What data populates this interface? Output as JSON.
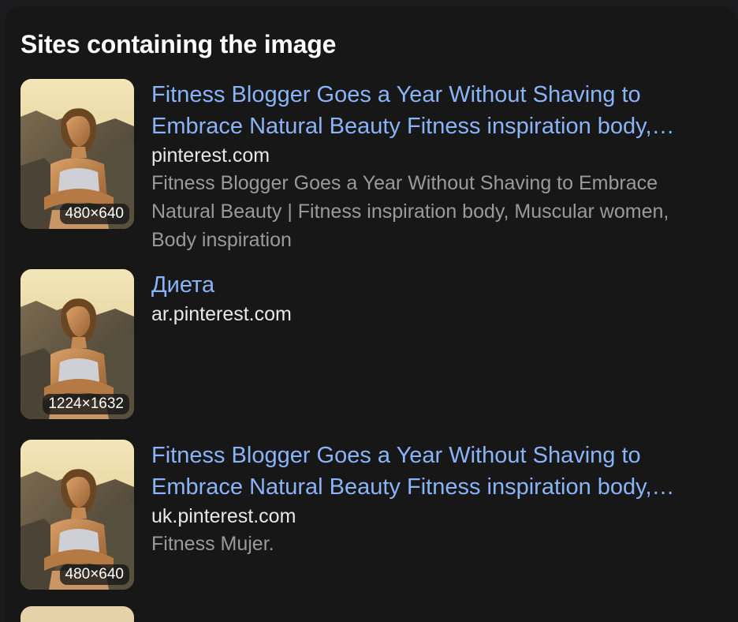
{
  "section": {
    "title": "Sites containing the image"
  },
  "results": [
    {
      "title": "Fitness Blogger Goes a Year Without Shaving to Embrace Natural Beauty Fitness inspiration body, Muscular women, Body inspiration",
      "site": "pinterest.com",
      "snippet": "Fitness Blogger Goes a Year Without Shaving to Embrace Natural Beauty | Fitness inspiration body, Muscular women, Body inspiration",
      "dimensions": "480×640"
    },
    {
      "title": "Диета",
      "site": "ar.pinterest.com",
      "snippet": "",
      "dimensions": "1224×1632"
    },
    {
      "title": "Fitness Blogger Goes a Year Without Shaving to Embrace Natural Beauty Fitness inspiration body, Muscular women, Body inspiration",
      "site": "uk.pinterest.com",
      "snippet": "Fitness Mujer.",
      "dimensions": "480×640"
    }
  ],
  "colors": {
    "background": "#171718",
    "link": "#8ab4f8",
    "site_text": "#e8e8e8",
    "snippet_text": "#9a9a9a"
  }
}
